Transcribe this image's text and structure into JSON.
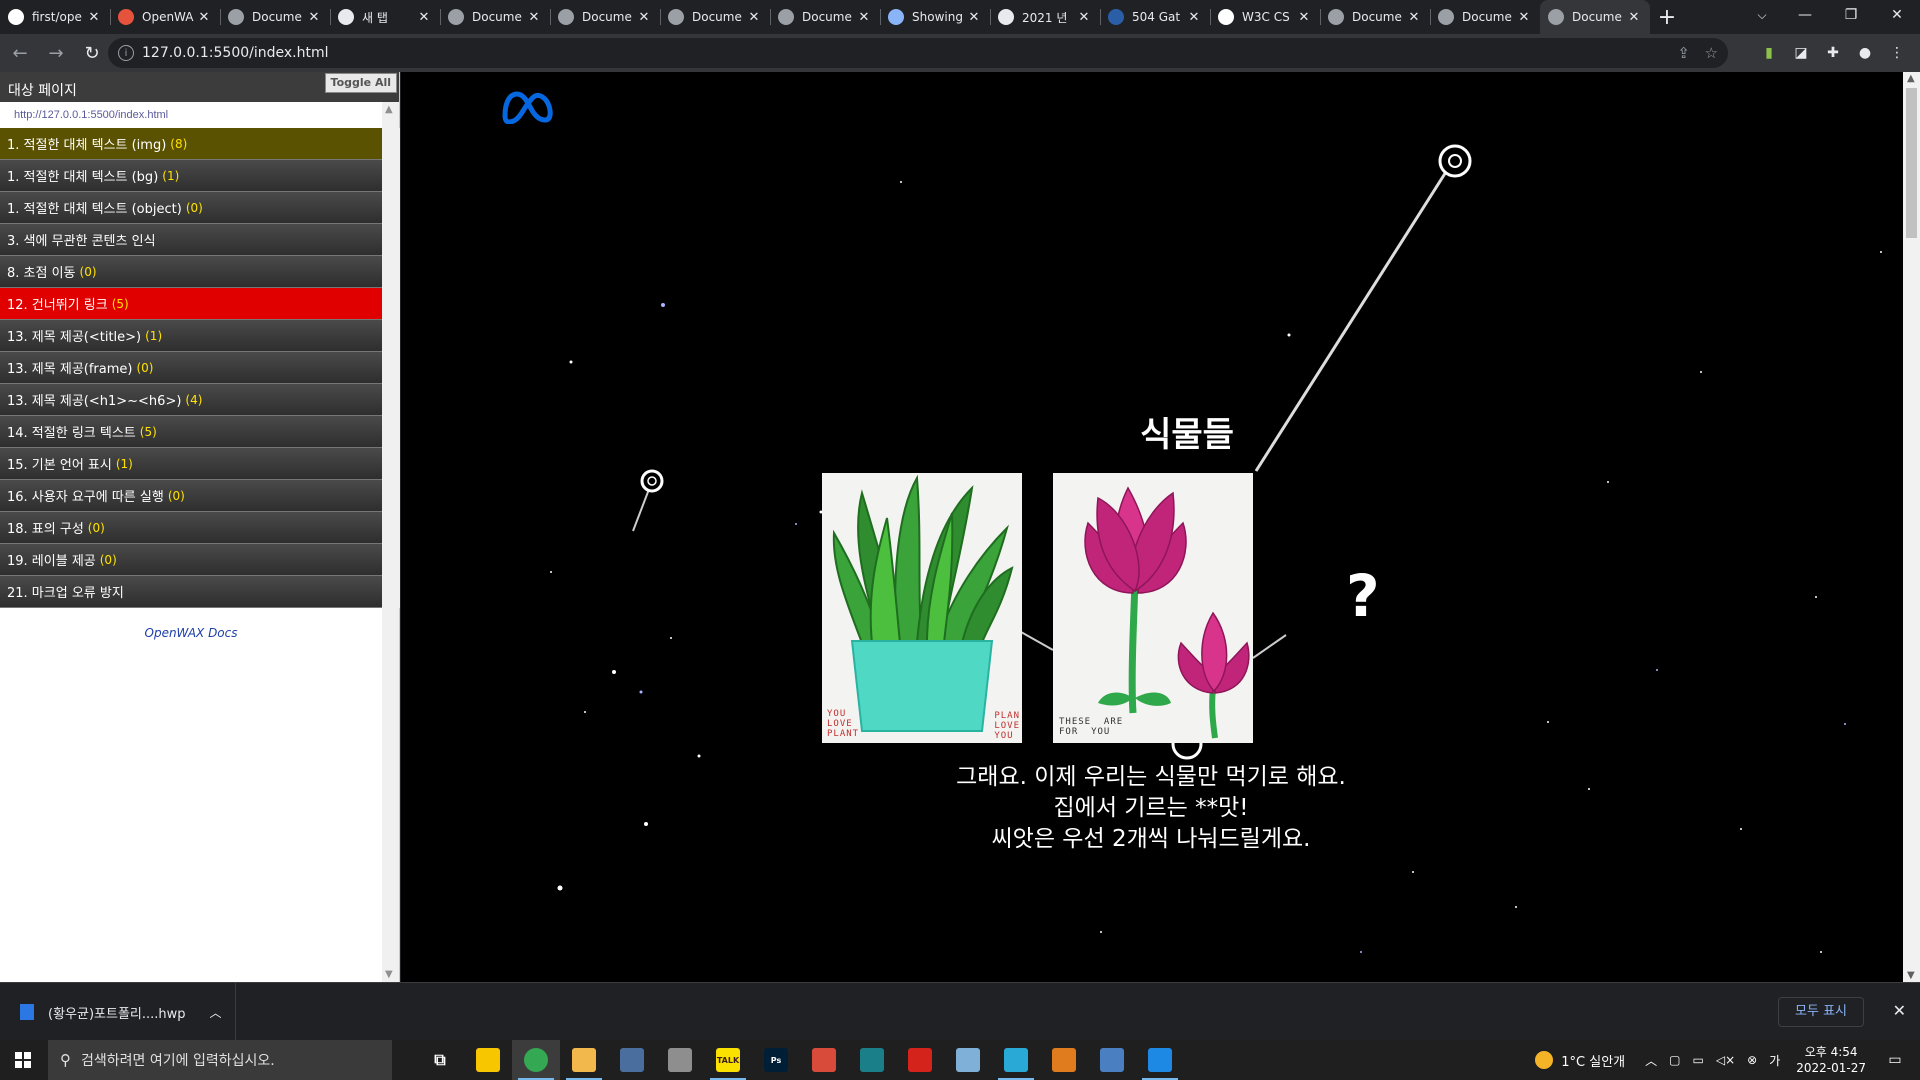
{
  "browser": {
    "tabs": [
      {
        "title": "first/ope",
        "icon": "github-icon",
        "color": "#ffffff"
      },
      {
        "title": "OpenWA",
        "icon": "openwax-icon",
        "color": "#e6533c"
      },
      {
        "title": "Docume",
        "icon": "globe-icon",
        "color": "#9aa0a6"
      },
      {
        "title": "새 탭",
        "icon": "chrome-icon",
        "color": "#e8eaed"
      },
      {
        "title": "Docume",
        "icon": "globe-icon",
        "color": "#9aa0a6"
      },
      {
        "title": "Docume",
        "icon": "globe-icon",
        "color": "#9aa0a6"
      },
      {
        "title": "Docume",
        "icon": "globe-icon",
        "color": "#9aa0a6"
      },
      {
        "title": "Docume",
        "icon": "globe-icon",
        "color": "#9aa0a6"
      },
      {
        "title": "Showing",
        "icon": "nu-icon",
        "color": "#8ab4f8"
      },
      {
        "title": "2021 년",
        "icon": "site-icon",
        "color": "#e8eaed"
      },
      {
        "title": "504 Gat",
        "icon": "w3-icon",
        "color": "#2a5fa8"
      },
      {
        "title": "W3C CS",
        "icon": "w3c-icon",
        "color": "#ffffff"
      },
      {
        "title": "Docume",
        "icon": "globe-icon",
        "color": "#9aa0a6"
      },
      {
        "title": "Docume",
        "icon": "globe-icon",
        "color": "#9aa0a6"
      },
      {
        "title": "Docume",
        "icon": "globe-icon",
        "color": "#9aa0a6"
      }
    ],
    "active_tab_index": 14,
    "url": "127.0.0.1:5500/index.html"
  },
  "panel": {
    "header": "대상 페이지",
    "toggle_all": "Toggle All",
    "target_url": "http://127.0.0.1:5500/index.html",
    "items": [
      {
        "label": "1. 적절한 대체 텍스트 (img)",
        "count": "(8)",
        "style": "olive"
      },
      {
        "label": "1. 적절한 대체 텍스트 (bg)",
        "count": "(1)",
        "style": "dark"
      },
      {
        "label": "1. 적절한 대체 텍스트 (object)",
        "count": "(0)",
        "style": "dark"
      },
      {
        "label": "3. 색에 무관한 콘텐츠 인식",
        "count": "",
        "style": "dark"
      },
      {
        "label": "8. 초점 이동",
        "count": "(0)",
        "style": "dark"
      },
      {
        "label": "12. 건너뛰기 링크",
        "count": "(5)",
        "style": "red"
      },
      {
        "label": "13. 제목 제공(<title>)",
        "count": "(1)",
        "style": "dark"
      },
      {
        "label": "13. 제목 제공(frame)",
        "count": "(0)",
        "style": "dark"
      },
      {
        "label": "13. 제목 제공(<h1>~<h6>)",
        "count": "(4)",
        "style": "dark"
      },
      {
        "label": "14. 적절한 링크 텍스트",
        "count": "(5)",
        "style": "dark"
      },
      {
        "label": "15. 기본 언어 표시",
        "count": "(1)",
        "style": "dark"
      },
      {
        "label": "16. 사용자 요구에 따른 실행",
        "count": "(0)",
        "style": "dark"
      },
      {
        "label": "18. 표의 구성",
        "count": "(0)",
        "style": "dark"
      },
      {
        "label": "19. 레이블 제공",
        "count": "(0)",
        "style": "dark"
      },
      {
        "label": "21. 마크업 오류 방지",
        "count": "",
        "style": "dark"
      }
    ],
    "docs_link": "OpenWAX Docs"
  },
  "page": {
    "section_title": "식물들",
    "card1_caption": "YOU\nLOVE\nPLANT",
    "card1_caption2": "PLAN\nLOVE\nYOU",
    "card2_caption": "THESE  ARE\nFOR  YOU",
    "question_mark": "?",
    "description": [
      "그래요. 이제 우리는 식물만 먹기로 해요.",
      "집에서 기르는 **맛!",
      "씨앗은 우선 2개씩 나눠드릴게요."
    ],
    "brand_color": "#0668e1"
  },
  "downloads": {
    "file_name": "(황우균)포트폴리....hwp",
    "show_all": "모두 표시"
  },
  "taskbar": {
    "search_placeholder": "검색하려면 여기에 입력하십시오.",
    "apps": [
      {
        "name": "task-view",
        "label": "",
        "color": "#1f1f1f"
      },
      {
        "name": "sticky-notes",
        "label": "",
        "color": "#f7c600"
      },
      {
        "name": "chrome",
        "label": "",
        "color": "#34a853"
      },
      {
        "name": "file-explorer",
        "label": "",
        "color": "#f2b84b"
      },
      {
        "name": "calculator",
        "label": "",
        "color": "#4a6f9e"
      },
      {
        "name": "mail",
        "label": "",
        "color": "#8e8e8e"
      },
      {
        "name": "kakaotalk",
        "label": "TALK",
        "color": "#fae100"
      },
      {
        "name": "photoshop",
        "label": "Ps",
        "color": "#001e36"
      },
      {
        "name": "scissors",
        "label": "",
        "color": "#d84a3a"
      },
      {
        "name": "app-teal",
        "label": "",
        "color": "#1b7f8a"
      },
      {
        "name": "acrobat",
        "label": "",
        "color": "#d4231b"
      },
      {
        "name": "notepad",
        "label": "",
        "color": "#7fb1d8"
      },
      {
        "name": "app-cyan",
        "label": "",
        "color": "#29a9d6"
      },
      {
        "name": "app-orange",
        "label": "",
        "color": "#e07b1e"
      },
      {
        "name": "app-paper",
        "label": "",
        "color": "#4a7fc1"
      },
      {
        "name": "vscode",
        "label": "",
        "color": "#1e88e5"
      }
    ],
    "weather": "1°C  실안개",
    "time": "오후 4:54",
    "date": "2022-01-27"
  }
}
